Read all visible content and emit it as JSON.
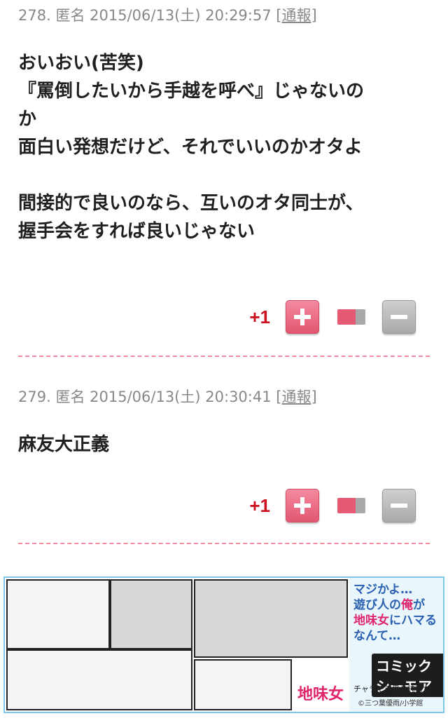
{
  "comments": [
    {
      "number": "278.",
      "author": "匿名",
      "date": "2015/06/13(土)",
      "time": "20:29:57",
      "report_label": "通報",
      "lines": [
        "おいおい(苦笑)",
        "『罵倒したいから手越を呼べ』じゃないの",
        "か",
        "面白い発想だけど、それでいいのかオタよ",
        "",
        "間接的で良いのなら、互いのオタ同士が、",
        "握手会をすれば良いじゃない"
      ],
      "score": "+1",
      "vote_ratio": 0.65
    },
    {
      "number": "279.",
      "author": "匿名",
      "date": "2015/06/13(土)",
      "time": "20:30:41",
      "report_label": "通報",
      "lines": [
        "麻友大正義"
      ],
      "score": "+1",
      "vote_ratio": 0.65
    }
  ],
  "ad": {
    "tagline_line1": "マジかよ…",
    "tagline_line2a": "遊び人の",
    "tagline_line2b": "俺",
    "tagline_line2c": "が",
    "tagline_line3a": "地味女",
    "tagline_line3b": "にハマる",
    "tagline_line4": "なんて…",
    "logo": "コミックシーモア",
    "label": "地味女",
    "title": "チャラモテ男と純情女",
    "copyright": "©三つ葉優雨/小学館"
  },
  "colors": {
    "score": "#cc1020",
    "plus_button": "#e65a73",
    "minus_button": "#a9a9a9",
    "divider": "#f08aa0",
    "banner_border": "#7fc7e8"
  }
}
